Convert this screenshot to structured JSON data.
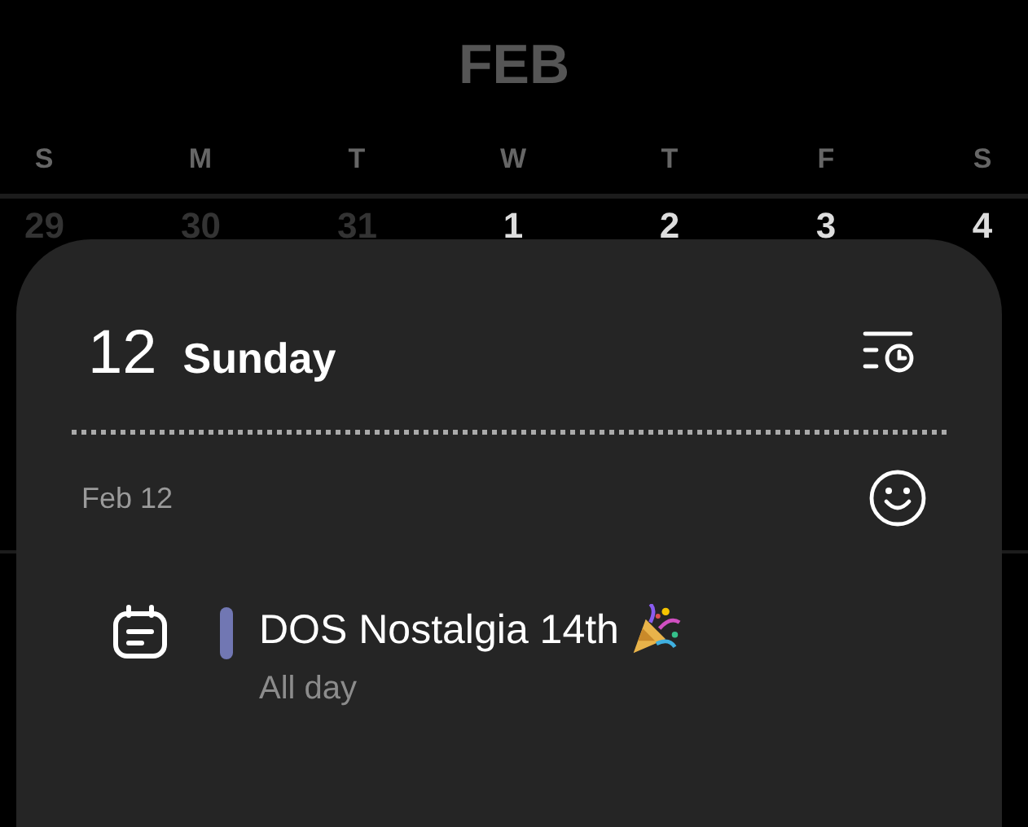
{
  "calendar": {
    "month": "FEB",
    "weekdays": [
      "S",
      "M",
      "T",
      "W",
      "T",
      "F",
      "S"
    ],
    "dates": [
      {
        "label": "29",
        "in_month": false
      },
      {
        "label": "30",
        "in_month": false
      },
      {
        "label": "31",
        "in_month": false
      },
      {
        "label": "1",
        "in_month": true
      },
      {
        "label": "2",
        "in_month": true
      },
      {
        "label": "3",
        "in_month": true
      },
      {
        "label": "4",
        "in_month": true
      }
    ]
  },
  "day_sheet": {
    "day_number": "12",
    "weekday": "Sunday",
    "date_label": "Feb 12",
    "events": [
      {
        "title": "DOS Nostalgia 14th",
        "time": "All day",
        "color": "#7177b3"
      }
    ]
  }
}
